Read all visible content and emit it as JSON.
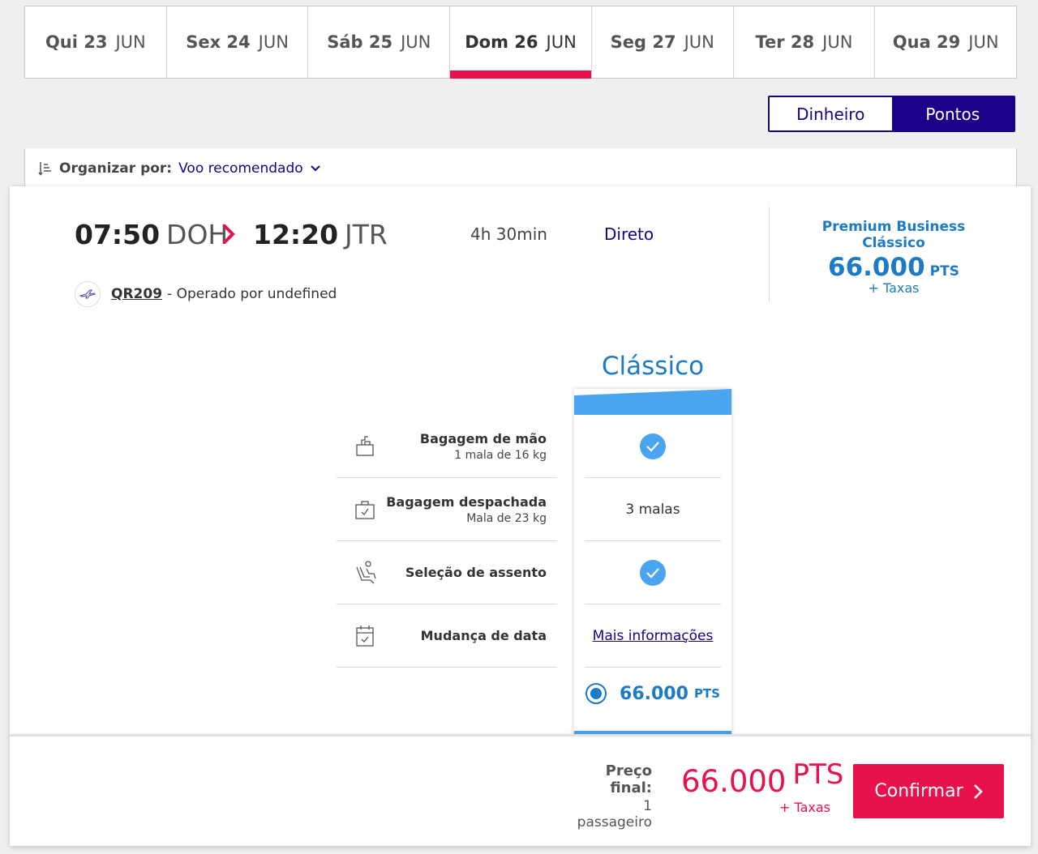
{
  "date_tabs": [
    {
      "weekday": "Qui 23",
      "month": "JUN",
      "active": false
    },
    {
      "weekday": "Sex 24",
      "month": "JUN",
      "active": false
    },
    {
      "weekday": "Sáb 25",
      "month": "JUN",
      "active": false
    },
    {
      "weekday": "Dom 26",
      "month": "JUN",
      "active": true
    },
    {
      "weekday": "Seg 27",
      "month": "JUN",
      "active": false
    },
    {
      "weekday": "Ter 28",
      "month": "JUN",
      "active": false
    },
    {
      "weekday": "Qua 29",
      "month": "JUN",
      "active": false
    }
  ],
  "toggle": {
    "money_label": "Dinheiro",
    "points_label": "Pontos",
    "active": "points"
  },
  "sort": {
    "label": "Organizar por:",
    "value": "Voo recomendado"
  },
  "flight": {
    "departure_time": "07:50",
    "departure_code": "DOH",
    "arrival_time": "12:20",
    "arrival_code": "JTR",
    "duration": "4h 30min",
    "stops": "Direto",
    "flight_number": "QR209",
    "operated_by": "- Operado por undefined"
  },
  "fare_summary": {
    "name": "Premium Business Clássico",
    "price": "66.000",
    "unit": "PTS",
    "taxes": "+ Taxas"
  },
  "class_option": {
    "title": "Clássico",
    "checked_baggage": "3 malas",
    "more_info": "Mais informações",
    "price": "66.000",
    "unit": "PTS"
  },
  "features": {
    "carry_on_title": "Bagagem de mão",
    "carry_on_sub": "1 mala de 16 kg",
    "checked_title": "Bagagem despachada",
    "checked_sub": "Mala de 23 kg",
    "seat_title": "Seleção de assento",
    "change_title": "Mudança de data"
  },
  "footer": {
    "final_price_label": "Preço final:",
    "passengers": "1 passageiro",
    "price": "66.000",
    "unit": "PTS",
    "taxes": "+ Taxas",
    "confirm_label": "Confirmar"
  },
  "colors": {
    "accent_red": "#e8114b",
    "brand_navy": "#1b0088",
    "fare_blue": "#1c7bc4",
    "class_blue": "#4aa4ef"
  }
}
